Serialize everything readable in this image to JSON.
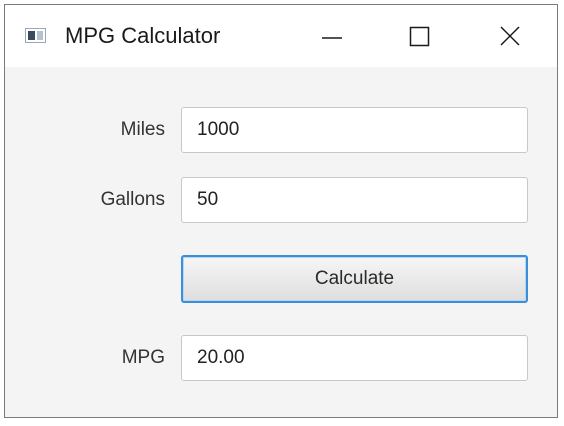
{
  "window": {
    "title": "MPG Calculator"
  },
  "icons": {
    "app": "app-window-icon",
    "minimize": "minimize-icon",
    "maximize": "maximize-icon",
    "close": "close-icon"
  },
  "form": {
    "miles_label": "Miles",
    "miles_value": "1000",
    "gallons_label": "Gallons",
    "gallons_value": "50",
    "calculate_label": "Calculate",
    "mpg_label": "MPG",
    "mpg_value": "20.00"
  },
  "colors": {
    "focus_accent": "#3b8ed8",
    "window_background": "#f4f4f4",
    "titlebar_background": "#ffffff"
  }
}
